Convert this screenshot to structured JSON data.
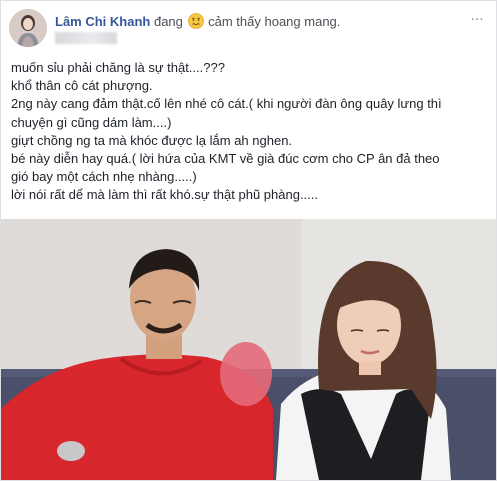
{
  "post": {
    "author_name": "Lâm Chi Khanh",
    "status_prefix": "đang",
    "feeling_icon": "confused-face-emoji",
    "feeling_text": "cảm thấy hoang mang.",
    "options_icon": "more-options-icon",
    "options_label": "...",
    "text_lines": [
      "muốn sỉu phải chăng là sự thật....???",
      "khổ thân cô cát phượng.",
      "2ng này cang đảm thật.cố lên nhé cô cát.( khi người đàn ông quây lưng thì",
      "chuyện gì cũng dám làm....)",
      "giựt chồng ng ta mà khóc được lạ lắm ah nghen.",
      "bé này diễn hay quá.( lời hứa của KMT về già đúc cơm cho CP ân đả theo",
      "gió bay một cách nhẹ nhàng.....)",
      "lời nói rất dể mà làm thì rất khó.sự thật phũ phàng....."
    ],
    "photo_icon": "post-photo"
  },
  "colors": {
    "author": "#365899",
    "text": "#1d2129",
    "muted": "#90949c",
    "border": "#dddfe2"
  }
}
